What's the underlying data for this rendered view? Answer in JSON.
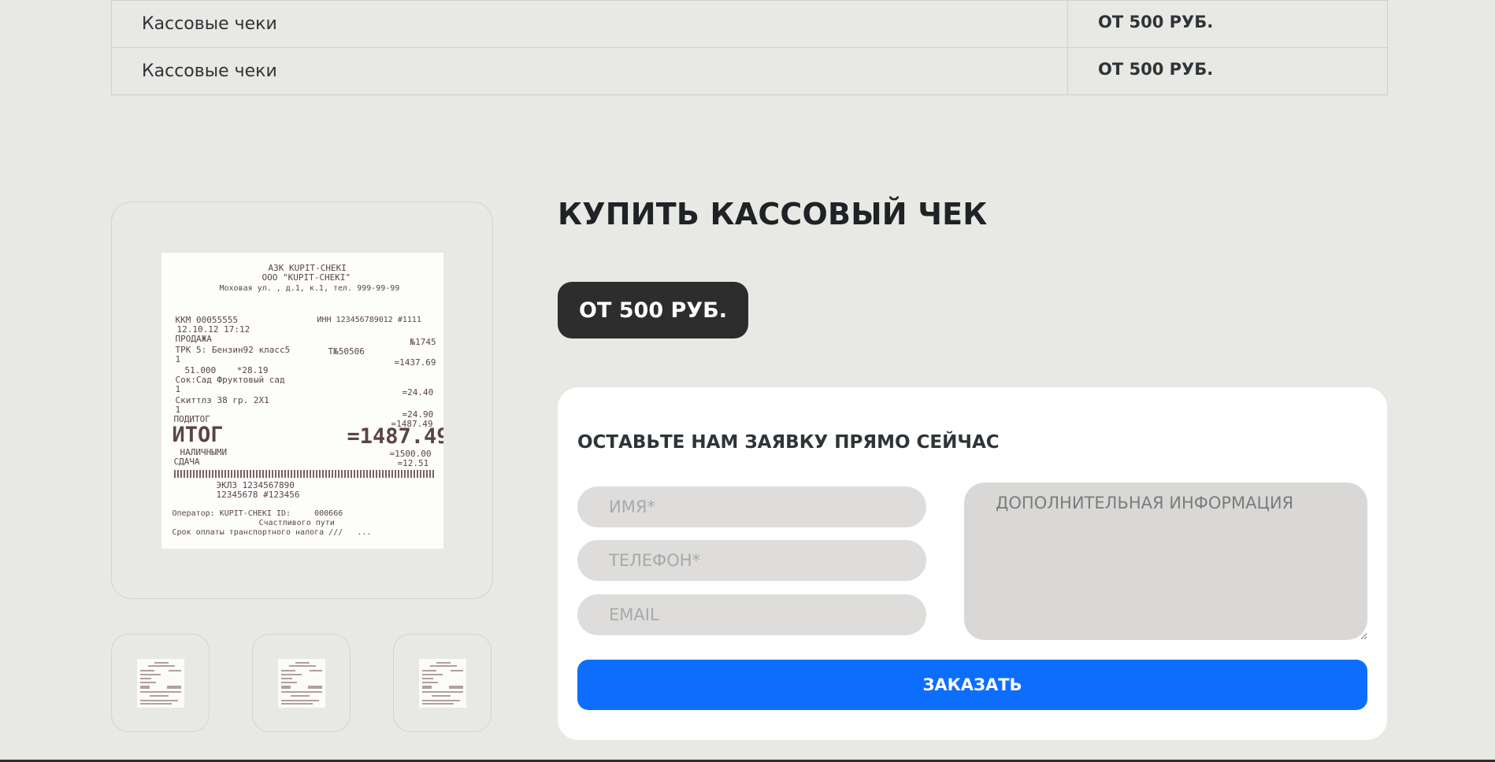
{
  "price_table": {
    "rows": [
      {
        "name": "Кассовые чеки",
        "price": "ОТ 500 РУБ."
      },
      {
        "name": "Кассовые чеки",
        "price": "ОТ 500 РУБ."
      }
    ]
  },
  "product": {
    "title": "КУПИТЬ КАССОВЫЙ ЧЕК",
    "price_badge": "ОТ 500 РУБ."
  },
  "gallery": {
    "main_image": "receipt-image",
    "thumbnails": [
      "receipt-thumbnail",
      "receipt-thumbnail",
      "receipt-thumbnail"
    ],
    "receipt_text": {
      "header": [
        "АЗК KUPIT-CHEKI",
        "ООО \"KUPIT-CHEKI\"",
        "Моховая ул. , д.1, к.1, тел. 999-99-99"
      ],
      "kkm": "ККМ 00055555",
      "inn": "ИНН 123456789012 #1111",
      "datetime": "12.10.12 17:12",
      "sale": "ПРОДАЖА",
      "n1": "№1745",
      "trk": "ТРК 5: Бензин92 класс5",
      "trk_code": "Т№50506",
      "one_a": "1",
      "sum1": "=1437.69",
      "qty": "51.000    *28.19",
      "item2": "Сок:Сад Фруктовый сад",
      "one_b": "1",
      "sum2": "=24.40",
      "item3": "Скиттлз 38 гр. 2X1",
      "one_c": "1",
      "sum3": "=24.90",
      "subtotal_label": "ПОДИТОГ",
      "subtotal": "=1487.49",
      "total_label": "ИТОГ",
      "total": "=1487.49",
      "cash_label": "НАЛИЧНЫМИ",
      "cash": "=1500.00",
      "change_label": "СДАЧА",
      "change": "=12.51",
      "eklz": "ЭКЛЗ 1234567890",
      "doc": "12345678 #123456",
      "operator": "Оператор: KUPIT-CHEKI ID:     000666",
      "wish": "Счастливого пути",
      "tax": "Срок оплаты транспортного налога ///   ..."
    }
  },
  "form": {
    "title": "ОСТАВЬТЕ НАМ ЗАЯВКУ ПРЯМО СЕЙЧАС",
    "name_placeholder": "ИМЯ*",
    "phone_placeholder": "ТЕЛЕФОН*",
    "email_placeholder": "EMAIL",
    "info_placeholder": "ДОПОЛНИТЕЛЬНАЯ ИНФОРМАЦИЯ",
    "submit_label": "ЗАКАЗАТЬ"
  },
  "colors": {
    "page_bg": "#e8e8e4",
    "badge_bg": "#2d2d2d",
    "accent": "#0d6efd",
    "field_bg": "#dedddc",
    "card_bg": "#ffffff"
  }
}
